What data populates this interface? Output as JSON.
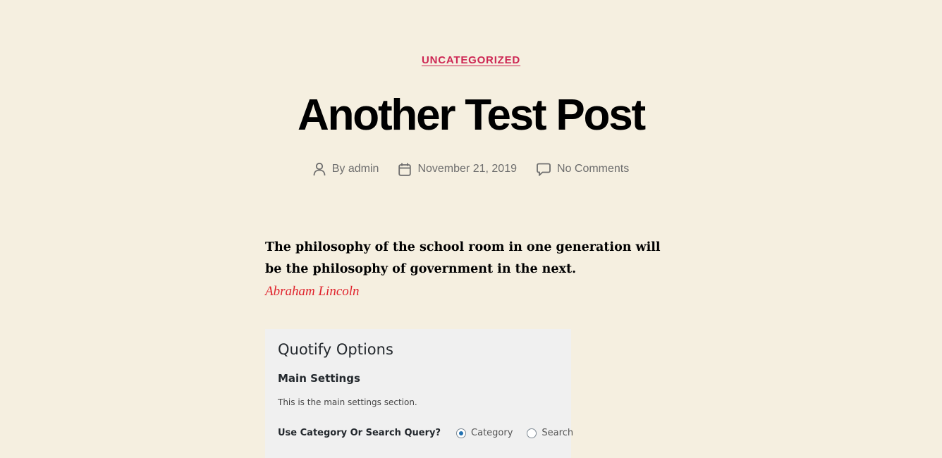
{
  "post": {
    "category": "UNCATEGORIZED",
    "title": "Another Test Post",
    "meta": {
      "author": "By admin",
      "date": "November 21, 2019",
      "comments": "No Comments"
    }
  },
  "quote": {
    "text": "The philosophy of the school room in one generation will be the philosophy of government in the next.",
    "author": "Abraham Lincoln"
  },
  "options_panel": {
    "title": "Quotify Options",
    "section_title": "Main Settings",
    "section_description": "This is the main settings section.",
    "field_label": "Use Category Or Search Query?",
    "radio_options": [
      {
        "label": "Category",
        "checked": true
      },
      {
        "label": "Search",
        "checked": false
      }
    ]
  },
  "colors": {
    "background": "#f5efe0",
    "accent": "#cd2653",
    "quote_author": "#e0232c",
    "meta_text": "#6d6d6d",
    "panel_bg": "#f0f0f0",
    "radio_checked": "#2271b1"
  },
  "icons": {
    "author": "user-icon",
    "date": "calendar-icon",
    "comments": "comment-bubble-icon"
  }
}
